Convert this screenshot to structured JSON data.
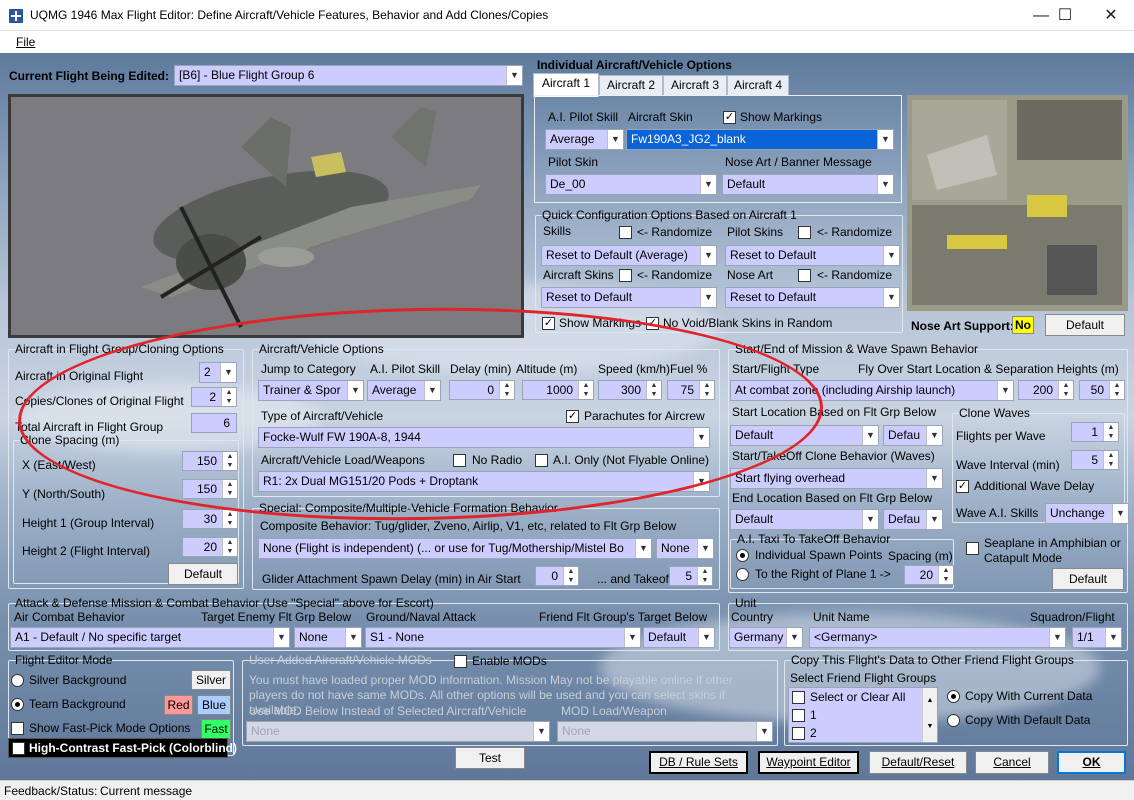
{
  "window": {
    "title": "UQMG 1946 Max Flight Editor:  Define Aircraft/Vehicle Features, Behavior and Add Clones/Copies",
    "minimize": "—",
    "maximize": "☐",
    "close": "✕"
  },
  "menu": {
    "file": "File"
  },
  "flight": {
    "label": "Current Flight Being Edited:",
    "value": "[B6] - Blue Flight Group  6"
  },
  "individual": {
    "title": "Individual Aircraft/Vehicle Options",
    "tabs": [
      "Aircraft 1",
      "Aircraft 2",
      "Aircraft 3",
      "Aircraft 4"
    ],
    "ai_skill_label": "A.I. Pilot Skill",
    "ai_skill": "Average",
    "skin_label": "Aircraft Skin",
    "skin": "Fw190A3_JG2_blank",
    "show_markings": "Show Markings",
    "pilot_skin_label": "Pilot Skin",
    "pilot_skin": "De_00",
    "nose_art_label": "Nose Art / Banner Message",
    "nose_art": "Default"
  },
  "quick": {
    "title": "Quick Configuration Options Based on Aircraft 1",
    "skills": "Skills",
    "randomize": "<- Randomize",
    "pilot_skins": "Pilot Skins",
    "skills_val": "Reset to Default (Average)",
    "pilot_skins_val": "Reset to Default",
    "aircraft_skins": "Aircraft Skins",
    "nose_art": "Nose Art",
    "aircraft_skins_val": "Reset to Default",
    "nose_art_val": "Reset to Default",
    "show_markings": "Show Markings",
    "no_void": "No Void/Blank Skins in Random"
  },
  "nose_art_support": {
    "label": "Nose Art Support:",
    "value": "No",
    "button": "Default"
  },
  "cloning": {
    "title": "Aircraft in Flight Group/Cloning Options",
    "orig_label": "Aircraft in Original Flight",
    "orig": "2",
    "copies_label": "Copies/Clones of Original Flight",
    "copies": "2",
    "total_label": "Total Aircraft in Flight Group",
    "total": "6",
    "spacing_title": "Clone Spacing (m)",
    "x_label": "X (East/West)",
    "x": "150",
    "y_label": "Y (North/South)",
    "y": "150",
    "h1_label": "Height 1 (Group Interval)",
    "h1": "30",
    "h2_label": "Height 2 (Flight Interval)",
    "h2": "20",
    "default_btn": "Default"
  },
  "vehicle": {
    "title": "Aircraft/Vehicle Options",
    "jump_label": "Jump to Category",
    "jump": "Trainer & Spor",
    "skill_label": "A.I. Pilot Skill",
    "skill": "Average",
    "delay_label": "Delay (min)",
    "delay": "0",
    "alt_label": "Altitude (m)",
    "alt": "1000",
    "speed_label": "Speed (km/h)",
    "speed": "300",
    "fuel_label": "Fuel %",
    "fuel": "75",
    "type_label": "Type of Aircraft/Vehicle",
    "parachutes": "Parachutes for Aircrew",
    "type": "Focke-Wulf FW 190A-8, 1944",
    "load_label": "Aircraft/Vehicle Load/Weapons",
    "no_radio": "No Radio",
    "ai_only": "A.I. Only (Not Flyable Online)",
    "load": "R1: 2x Dual MG151/20 Pods + Droptank"
  },
  "special": {
    "title": "Special: Composite/Multiple-Vehicle Formation Behavior",
    "comp_label": "Composite Behavior: Tug/glider, Zveno, Airlip, V1, etc, related to Flt Grp Below",
    "comp": "None (Flight is independent) (... or use for Tug/Mothership/Mistel Bo",
    "comp2": "None",
    "glider_label": "Glider Attachment Spawn Delay (min) in Air Start",
    "glider1": "0",
    "takeoff_label": "... and Takeoff",
    "glider2": "5"
  },
  "spawn": {
    "title": "Start/End of Mission & Wave Spawn Behavior",
    "start_type_label": "Start/Flight Type",
    "fly_over_label": "Fly Over Start Location & Separation Heights (m)",
    "start_type": "At combat zone (including Airship launch)",
    "h_a": "200",
    "h_b": "50",
    "start_loc_label": "Start Location Based on Flt Grp Below",
    "start_loc": "Default",
    "start_loc2": "Defau",
    "clone_label": "Start/TakeOff Clone Behavior (Waves)",
    "clone": "Start flying overhead",
    "end_loc_label": "End Location Based on Flt Grp Below",
    "end_loc": "Default",
    "end_loc2": "Defau",
    "taxi_title": "A.I. Taxi To TakeOff Behavior",
    "individual": "Individual Spawn Points",
    "spacing_label": "Spacing (m)",
    "right_of": "To the Right of Plane 1 ->",
    "spacing": "20"
  },
  "waves": {
    "title": "Clone Waves",
    "flights_label": "Flights per Wave",
    "flights": "1",
    "interval_label": "Wave Interval (min)",
    "interval": "5",
    "additional": "Additional Wave Delay",
    "skills_label": "Wave A.I. Skills",
    "skills": "Unchange",
    "seaplane": "Seaplane in Amphibian or Catapult Mode",
    "default_btn": "Default"
  },
  "attack": {
    "title": "Attack & Defense Mission & Combat Behavior (Use \"Special\" above for Escort)",
    "air_label": "Air Combat Behavior",
    "air": "A1 - Default / No specific target",
    "target_label": "Target Enemy Flt Grp Below",
    "target": "None",
    "ground_label": "Ground/Naval Attack",
    "ground": "S1 - None",
    "friend_label": "Friend Flt Group's Target Below",
    "friend": "Default"
  },
  "unit": {
    "title": "Unit",
    "country_label": "Country",
    "country": "Germany",
    "name_label": "Unit Name",
    "name": "<Germany>",
    "squadron_label": "Squadron/Flight",
    "squadron": "1/1"
  },
  "mode": {
    "title": "Flight Editor Mode",
    "silver": "Silver Background",
    "silver_btn": "Silver",
    "team": "Team Background",
    "red_btn": "Red",
    "blue_btn": "Blue",
    "fast": "Show Fast-Pick Mode Options",
    "fast_btn": "Fast",
    "contrast": "High-Contrast Fast-Pick (Colorblind)"
  },
  "mods": {
    "title": "User Added Aircraft/Vehicle MODs",
    "enable": "Enable MODs",
    "text": "You must have loaded proper MOD information. Mission May not be playable online if other players do not have same MODs.  All other options will be used and you can select skins if available.",
    "use_label": "Use MOD Below Instead of Selected Aircraft/Vehicle",
    "load_label": "MOD Load/Weapon",
    "mod": "None",
    "load": "None"
  },
  "copy": {
    "title": "Copy This Flight's Data to Other Friend Flight Groups",
    "select_label": "Select Friend Flight Groups",
    "items": [
      "Select or Clear All",
      "1",
      "2"
    ],
    "current": "Copy With Current Data",
    "default": "Copy With Default Data"
  },
  "buttons": {
    "test": "Test",
    "db": "DB / Rule Sets",
    "waypoint": "Waypoint Editor",
    "default_reset": "Default/Reset",
    "cancel": "Cancel",
    "ok": "OK"
  },
  "status": {
    "label": "Feedback/Status:",
    "message": "Current message"
  },
  "colors": {
    "field": "#ccccff",
    "highlight": "#0a64d8",
    "annotation": "#e0242a",
    "nose_art_badge": "#ffff00",
    "fast_btn": "#33ff66",
    "red_btn": "#ff9999",
    "blue_btn": "#aaccff"
  }
}
